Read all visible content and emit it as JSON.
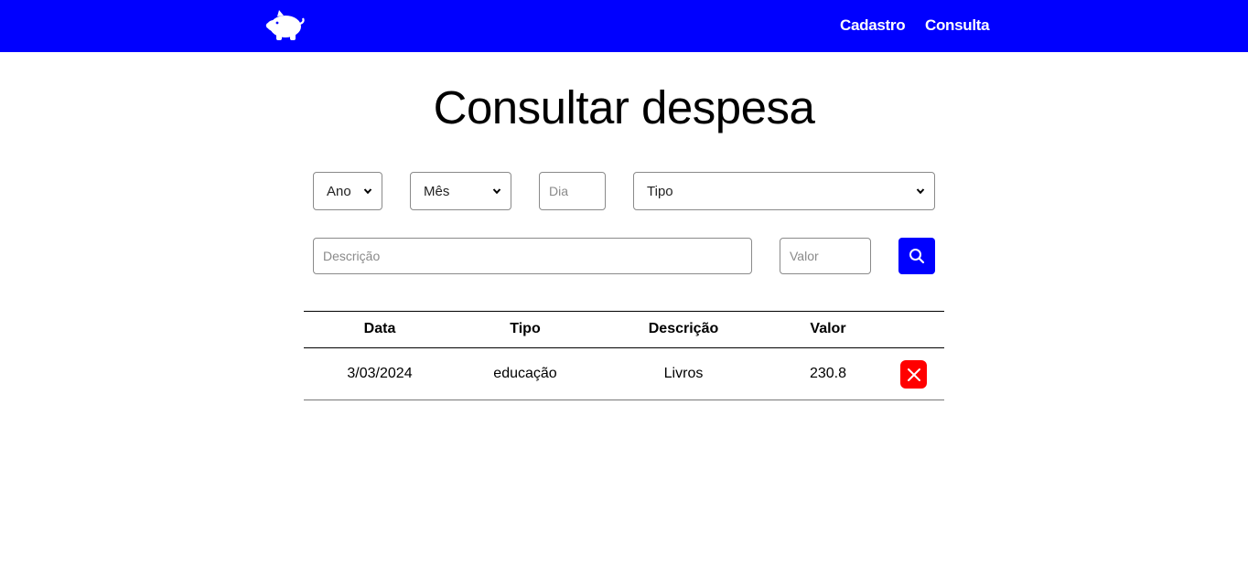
{
  "nav": {
    "logo_icon": "piggy-bank-icon",
    "links": [
      "Cadastro",
      "Consulta"
    ],
    "background": "#0000ff"
  },
  "main": {
    "title": "Consultar despesa"
  },
  "filters": {
    "ano": {
      "selected": "Ano"
    },
    "mes": {
      "selected": "Mês"
    },
    "dia": {
      "placeholder": "Dia"
    },
    "tipo": {
      "selected": "Tipo"
    },
    "descricao": {
      "placeholder": "Descrição"
    },
    "valor": {
      "placeholder": "Valor"
    },
    "search_icon": "search-icon",
    "search_button_color": "#0000ff"
  },
  "table": {
    "headers": [
      "Data",
      "Tipo",
      "Descrição",
      "Valor"
    ],
    "rows": [
      {
        "data": "3/03/2024",
        "tipo": "educação",
        "descricao": "Livros",
        "valor": "230.8",
        "delete_icon": "close-icon"
      }
    ],
    "delete_button_color": "#ff0000"
  }
}
